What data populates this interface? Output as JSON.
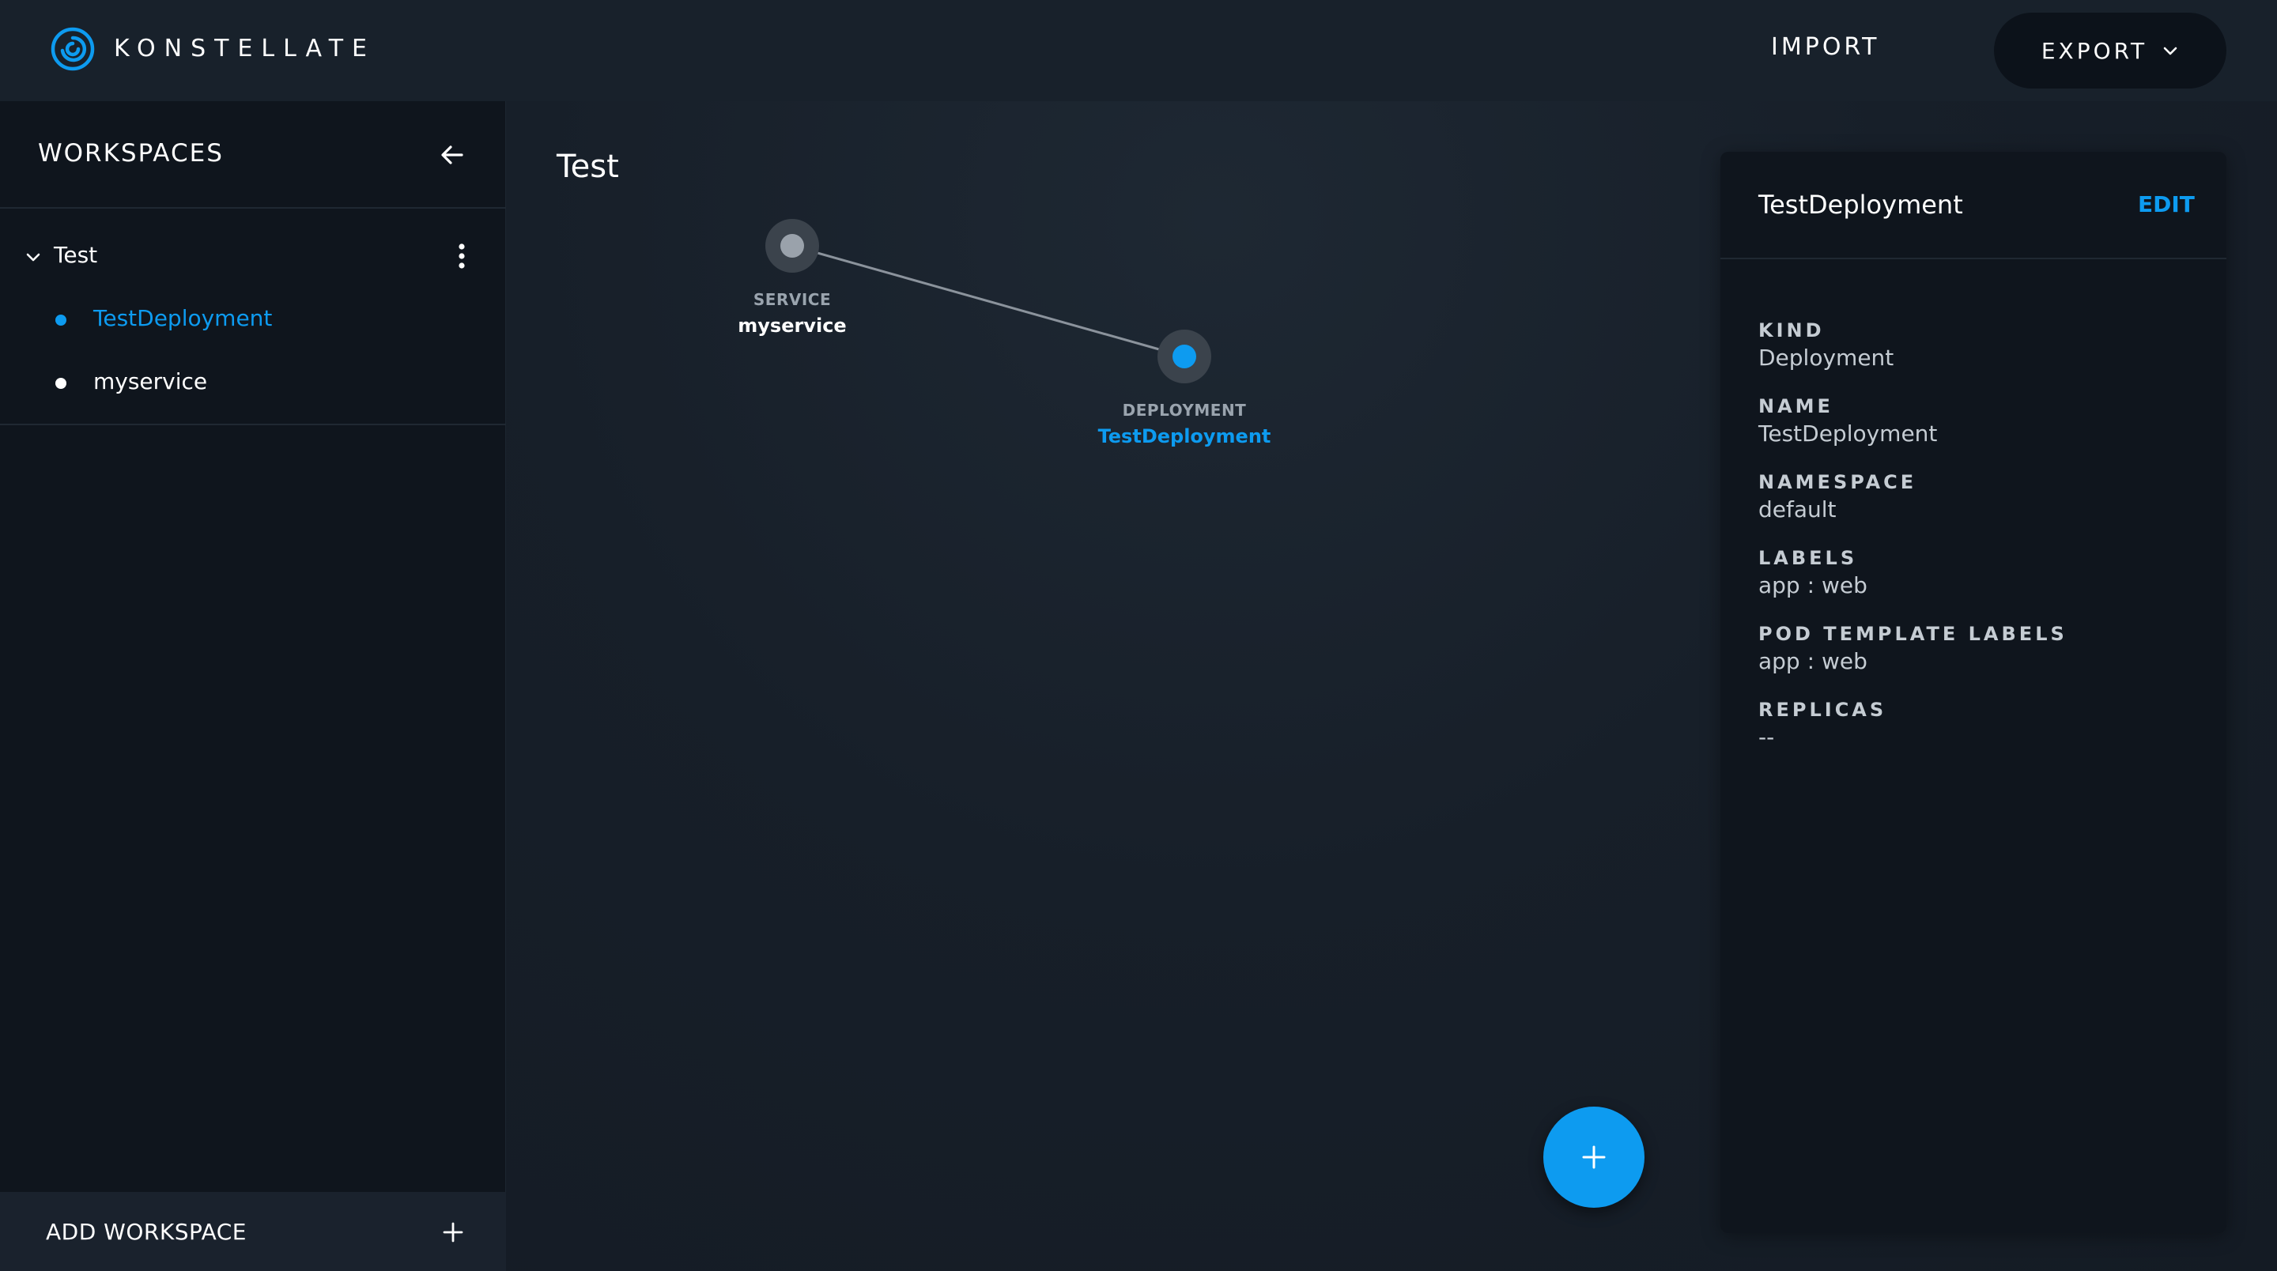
{
  "header": {
    "brand": "KONSTELLATE",
    "import_label": "IMPORT",
    "export_label": "EXPORT"
  },
  "sidebar": {
    "title": "WORKSPACES",
    "workspace": {
      "name": "Test",
      "resources": [
        {
          "label": "TestDeployment",
          "selected": true
        },
        {
          "label": "myservice",
          "selected": false
        }
      ]
    },
    "add_workspace_label": "ADD WORKSPACE"
  },
  "canvas": {
    "title": "Test",
    "nodes": [
      {
        "type": "SERVICE",
        "name": "myservice"
      },
      {
        "type": "DEPLOYMENT",
        "name": "TestDeployment",
        "selected": true
      }
    ]
  },
  "details": {
    "title": "TestDeployment",
    "edit_label": "EDIT",
    "properties": [
      {
        "key": "KIND",
        "value": "Deployment"
      },
      {
        "key": "NAME",
        "value": "TestDeployment"
      },
      {
        "key": "NAMESPACE",
        "value": "default"
      },
      {
        "key": "LABELS",
        "value": "app : web"
      },
      {
        "key": "POD TEMPLATE LABELS",
        "value": "app : web"
      },
      {
        "key": "REPLICAS",
        "value": "--"
      }
    ]
  },
  "colors": {
    "accent": "#0d9bf0",
    "background": "#151c25",
    "sidebar": "#0f151d",
    "header": "#18212b"
  }
}
